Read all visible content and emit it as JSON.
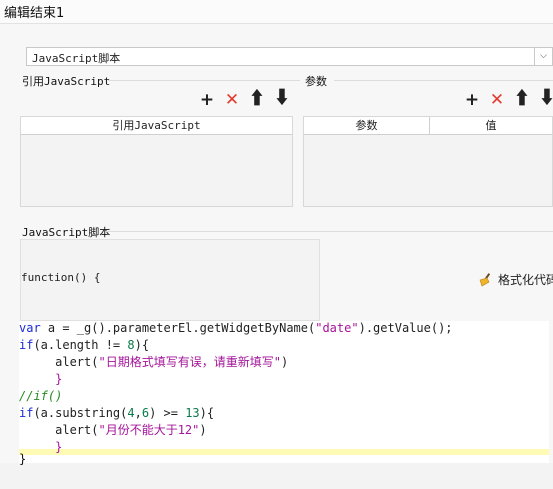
{
  "window": {
    "title": "编辑结束1"
  },
  "script_type": {
    "selected": "JavaScript脚本"
  },
  "ref_js": {
    "section_label": "引用JavaScript",
    "column_header": "引用JavaScript"
  },
  "params": {
    "section_label": "参数",
    "columns": [
      "参数",
      "值"
    ]
  },
  "toolbar_icons": [
    "add-icon",
    "delete-icon",
    "move-up-icon",
    "move-down-icon"
  ],
  "script": {
    "section_label": "JavaScript脚本",
    "function_header": "function() {",
    "format_label": "格式化代码",
    "closing": "}"
  },
  "code": [
    {
      "tokens": [
        {
          "t": "var",
          "c": "kw"
        },
        {
          "t": " a = _g().parameterEl.getWidgetByName(",
          "c": ""
        },
        {
          "t": "\"date\"",
          "c": "str"
        },
        {
          "t": ").getValue();",
          "c": ""
        }
      ]
    },
    {
      "tokens": [
        {
          "t": "if",
          "c": "kw"
        },
        {
          "t": "(a.length != ",
          "c": ""
        },
        {
          "t": "8",
          "c": "num"
        },
        {
          "t": "){",
          "c": ""
        }
      ]
    },
    {
      "tokens": [
        {
          "t": "     alert(",
          "c": ""
        },
        {
          "t": "\"日期格式填写有误，请重新填写\"",
          "c": "str"
        },
        {
          "t": ")",
          "c": ""
        }
      ]
    },
    {
      "tokens": [
        {
          "t": "     }",
          "c": "str"
        }
      ]
    },
    {
      "tokens": [
        {
          "t": "//if()",
          "c": "cmt"
        }
      ]
    },
    {
      "tokens": [
        {
          "t": "if",
          "c": "kw"
        },
        {
          "t": "(a.substring(",
          "c": ""
        },
        {
          "t": "4",
          "c": "num"
        },
        {
          "t": ",",
          "c": ""
        },
        {
          "t": "6",
          "c": "num"
        },
        {
          "t": ") >= ",
          "c": ""
        },
        {
          "t": "13",
          "c": "num"
        },
        {
          "t": "){",
          "c": ""
        }
      ]
    },
    {
      "tokens": [
        {
          "t": "     alert(",
          "c": ""
        },
        {
          "t": "\"月份不能大于12\"",
          "c": "str"
        },
        {
          "t": ")",
          "c": ""
        }
      ]
    },
    {
      "tokens": [
        {
          "t": "     }",
          "c": "str"
        }
      ]
    }
  ],
  "colors": {
    "keyword": "#1c2bd6",
    "string": "#a5149a",
    "number": "#0b7a4b",
    "comment": "#248a20",
    "delete": "#e23b2e",
    "current_line": "#fffbb5"
  }
}
